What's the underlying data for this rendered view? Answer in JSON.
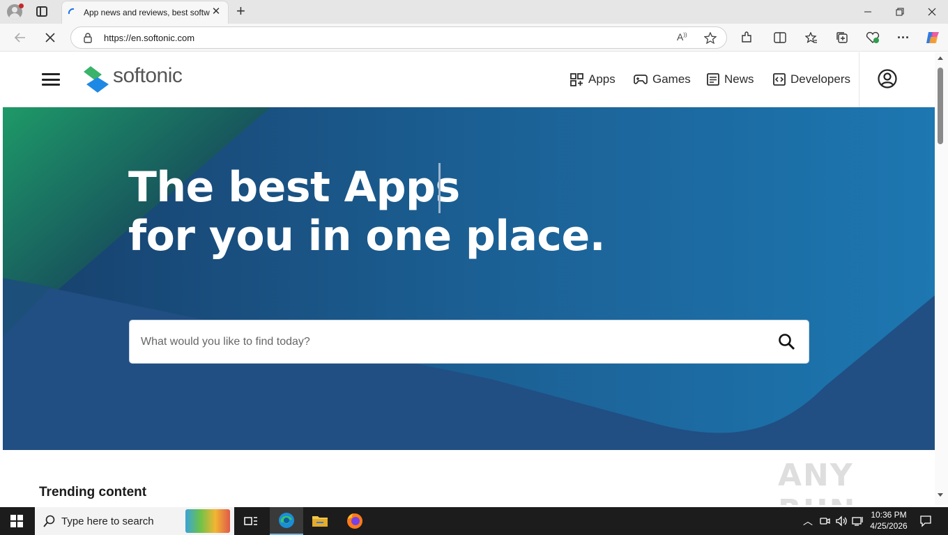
{
  "browser": {
    "tab_title": "App news and reviews, best softw",
    "url": "https://en.softonic.com",
    "new_tab_symbol": "+"
  },
  "site": {
    "brand": "softonic",
    "nav": [
      {
        "label": "Apps",
        "icon": "apps-grid-icon"
      },
      {
        "label": "Games",
        "icon": "gamepad-icon"
      },
      {
        "label": "News",
        "icon": "news-icon"
      },
      {
        "label": "Developers",
        "icon": "code-icon"
      }
    ]
  },
  "hero": {
    "line1": "The best Apps",
    "line2": "for you in one place.",
    "search_placeholder": "What would you like to find today?"
  },
  "sections": {
    "trending_title": "Trending content"
  },
  "watermark": "ANY RUN",
  "taskbar": {
    "search_placeholder": "Type here to search",
    "time": "10:36 PM",
    "date": "4/25/2026"
  },
  "colors": {
    "hero_blue": "#1f5b95",
    "hero_teal": "#1e9a68",
    "brand_green": "#3ab36b",
    "brand_blue": "#1e88e5",
    "taskbar": "#1c1c1c"
  }
}
